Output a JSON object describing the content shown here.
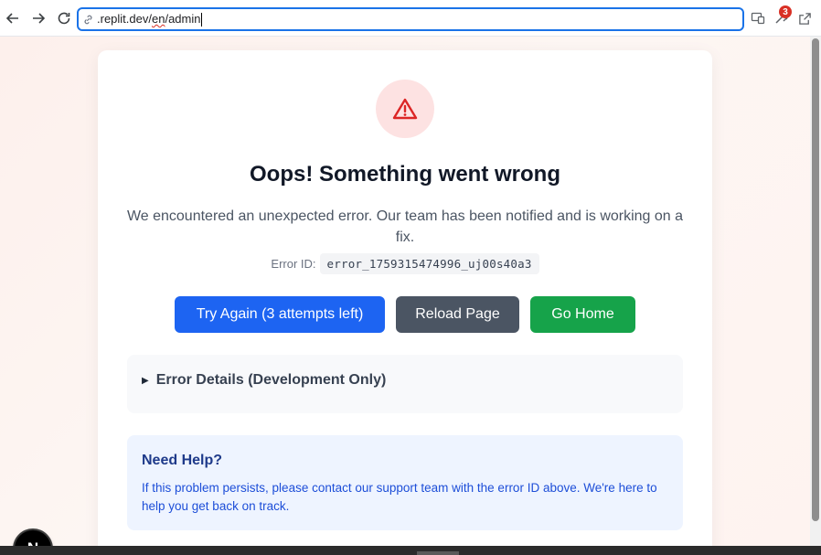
{
  "browser": {
    "url_prefix": ".replit.dev/",
    "url_locale": "en",
    "url_suffix": "/admin",
    "extensions_badge": "3"
  },
  "card": {
    "title": "Oops! Something went wrong",
    "description": "We encountered an unexpected error. Our team has been notified and is working on a fix.",
    "error_id_label": "Error ID:",
    "error_id_value": "error_1759315474996_uj00s40a3",
    "buttons": {
      "try_again": "Try Again (3 attempts left)",
      "reload": "Reload Page",
      "home": "Go Home"
    },
    "details_summary": "Error Details (Development Only)",
    "help": {
      "title": "Need Help?",
      "text": "If this problem persists, please contact our support team with the error ID above. We're here to help you get back on track."
    }
  },
  "fab": {
    "label": "N"
  },
  "colors": {
    "primary": "#1d64f2",
    "secondary": "#4b5563",
    "success": "#16a34a",
    "danger": "#dc2626"
  },
  "icons": [
    "back-arrow-icon",
    "forward-arrow-icon",
    "reload-icon",
    "link-icon",
    "cast-icon",
    "extensions-icon",
    "open-external-icon",
    "alert-triangle-icon"
  ]
}
